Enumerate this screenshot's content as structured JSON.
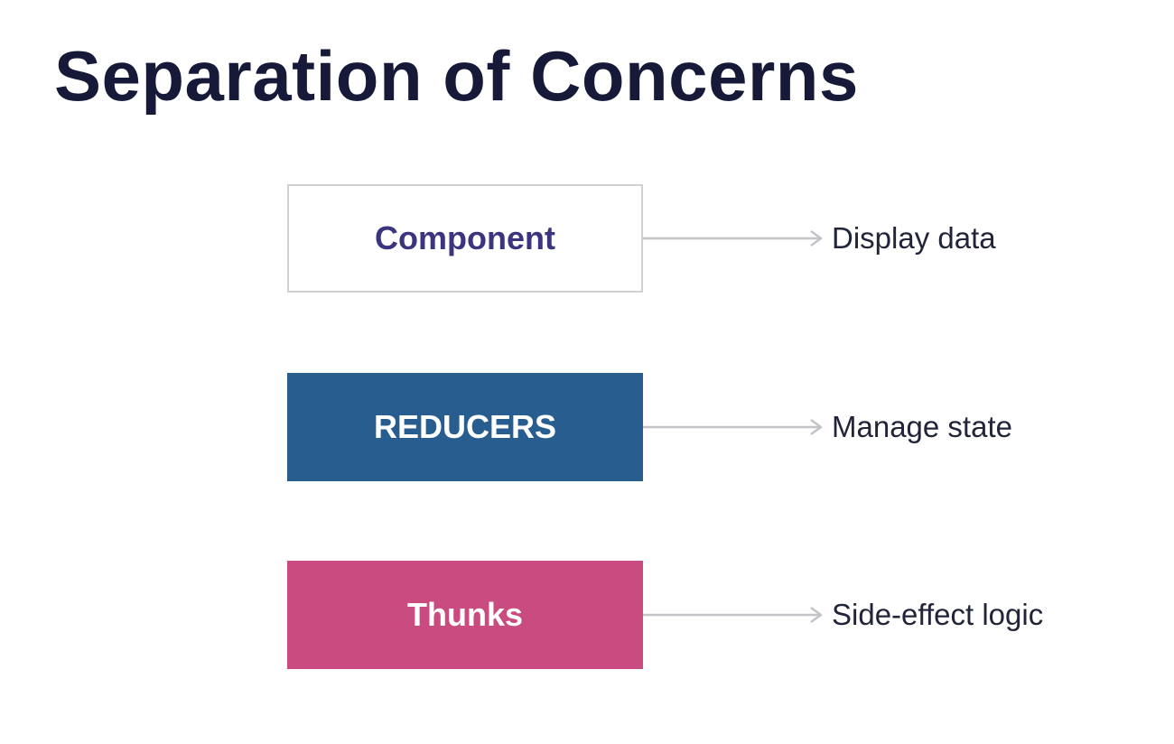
{
  "title": "Separation of Concerns",
  "rows": [
    {
      "box_label": "Component",
      "description": "Display data",
      "box_color": "#ffffff",
      "text_color": "#3b3580"
    },
    {
      "box_label": "REDUCERS",
      "description": "Manage state",
      "box_color": "#285d8f",
      "text_color": "#ffffff"
    },
    {
      "box_label": "Thunks",
      "description": "Side-effect logic",
      "box_color": "#ca4b7f",
      "text_color": "#ffffff"
    }
  ],
  "arrow_color": "#c4c4c8"
}
